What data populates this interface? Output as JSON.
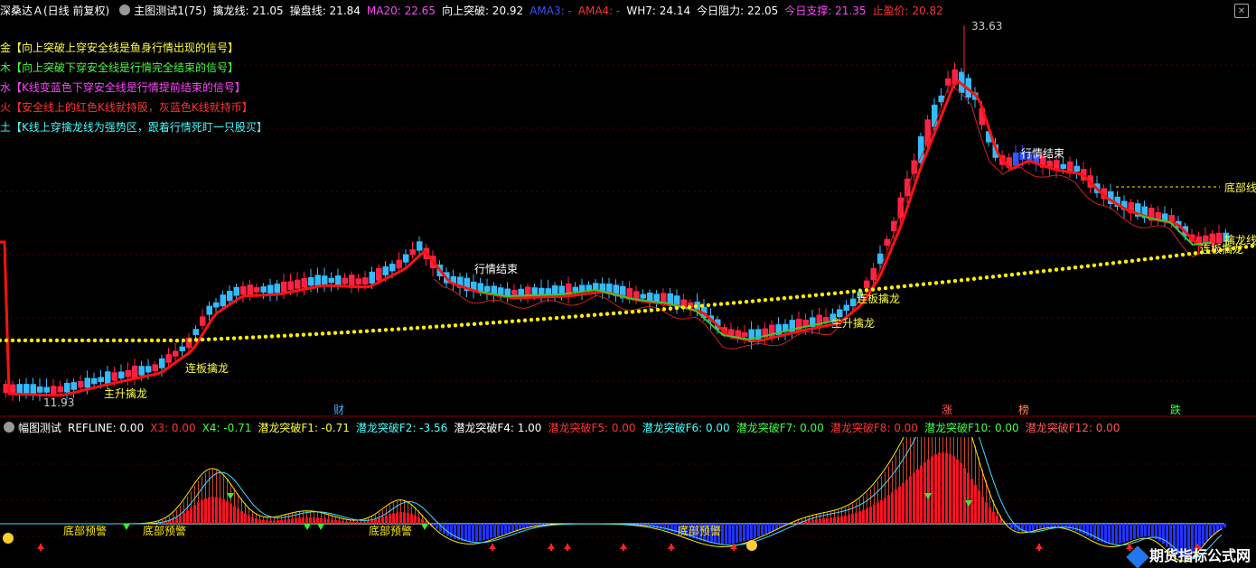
{
  "header": {
    "title": "深桑达Ａ(日线 前复权)",
    "indicator_name": "主图测试1(75)",
    "values": [
      {
        "label": "擒龙线: 21.05",
        "color": "#ffffff"
      },
      {
        "label": "操盘线: 21.84",
        "color": "#ffffff"
      },
      {
        "label": "MA20: 22.65",
        "color": "#ff44ff"
      },
      {
        "label": "向上突破: 20.92",
        "color": "#ffffff"
      },
      {
        "label": "AMA3: -",
        "color": "#3355ff"
      },
      {
        "label": "AMA4: -",
        "color": "#ff3333"
      },
      {
        "label": "WH7: 24.14",
        "color": "#ffffff"
      },
      {
        "label": "今日阻力: 22.05",
        "color": "#ffffff"
      },
      {
        "label": "今日支撑: 21.35",
        "color": "#ff44ff"
      },
      {
        "label": "止盈价: 20.82",
        "color": "#ff3333"
      }
    ]
  },
  "legend": [
    {
      "text": "金【向上突破上穿安全线是鱼身行情出现的信号】",
      "color": "#ffff44"
    },
    {
      "text": "木【向上突破下穿安全线是行情完全结束的信号】",
      "color": "#44ff44"
    },
    {
      "text": "水【K线变蓝色下穿安全线是行情提前结束的信号】",
      "color": "#ff44ff"
    },
    {
      "text": "火【安全线上的红色K线就持股，灰蓝色K线就持币】",
      "color": "#ff3333"
    },
    {
      "text": "土【K线上穿擒龙线为强势区，跟着行情死盯一只股买】",
      "color": "#44ffff"
    }
  ],
  "main_chart": {
    "high_label": "33.63",
    "low_label": "11.93",
    "annotations": [
      {
        "text": "主升擒龙",
        "color": "#ffff44"
      },
      {
        "text": "连板擒龙",
        "color": "#ffff44"
      },
      {
        "text": "行情结束",
        "color": "#ffffff"
      },
      {
        "text": "连板擒龙",
        "color": "#ffff44"
      },
      {
        "text": "主升擒龙",
        "color": "#ffff44"
      },
      {
        "text": "行情结束",
        "color": "#ffffff"
      },
      {
        "text": "底部线",
        "color": "#ffff44"
      },
      {
        "text": "擒龙线",
        "color": "#ffff44"
      },
      {
        "text": "连板擒龙",
        "color": "#ffff44"
      }
    ],
    "markers": [
      {
        "text": "财",
        "color": "#44aaff"
      },
      {
        "text": "涨",
        "color": "#ff5555"
      },
      {
        "text": "榜",
        "color": "#ff8855"
      },
      {
        "text": "跌",
        "color": "#44ff44"
      }
    ]
  },
  "sub_header": {
    "title": "幅图测试",
    "values": [
      {
        "label": "REFLINE: 0.00",
        "color": "#ffffff"
      },
      {
        "label": "X3: 0.00",
        "color": "#ff3333"
      },
      {
        "label": "X4: -0.71",
        "color": "#44ff44"
      },
      {
        "label": "潜龙突破F1: -0.71",
        "color": "#ffff44"
      },
      {
        "label": "潜龙突破F2: -3.56",
        "color": "#44ffff"
      },
      {
        "label": "潜龙突破F4: 1.00",
        "color": "#ffffff"
      },
      {
        "label": "潜龙突破F5: 0.00",
        "color": "#ff3333"
      },
      {
        "label": "潜龙突破F6: 0.00",
        "color": "#44ffff"
      },
      {
        "label": "潜龙突破F7: 0.00",
        "color": "#44ff44"
      },
      {
        "label": "潜龙突破F8: 0.00",
        "color": "#ff3333"
      },
      {
        "label": "潜龙突破F10: 0.00",
        "color": "#44ff44"
      },
      {
        "label": "潜龙突破F12: 0.00",
        "color": "#ff5555"
      }
    ]
  },
  "sub_chart": {
    "warning_label": "底部预警",
    "warnings": [
      "底部预警",
      "底部预警",
      "底部预警",
      "底部预警"
    ]
  },
  "watermark": "期货指标公式网"
}
